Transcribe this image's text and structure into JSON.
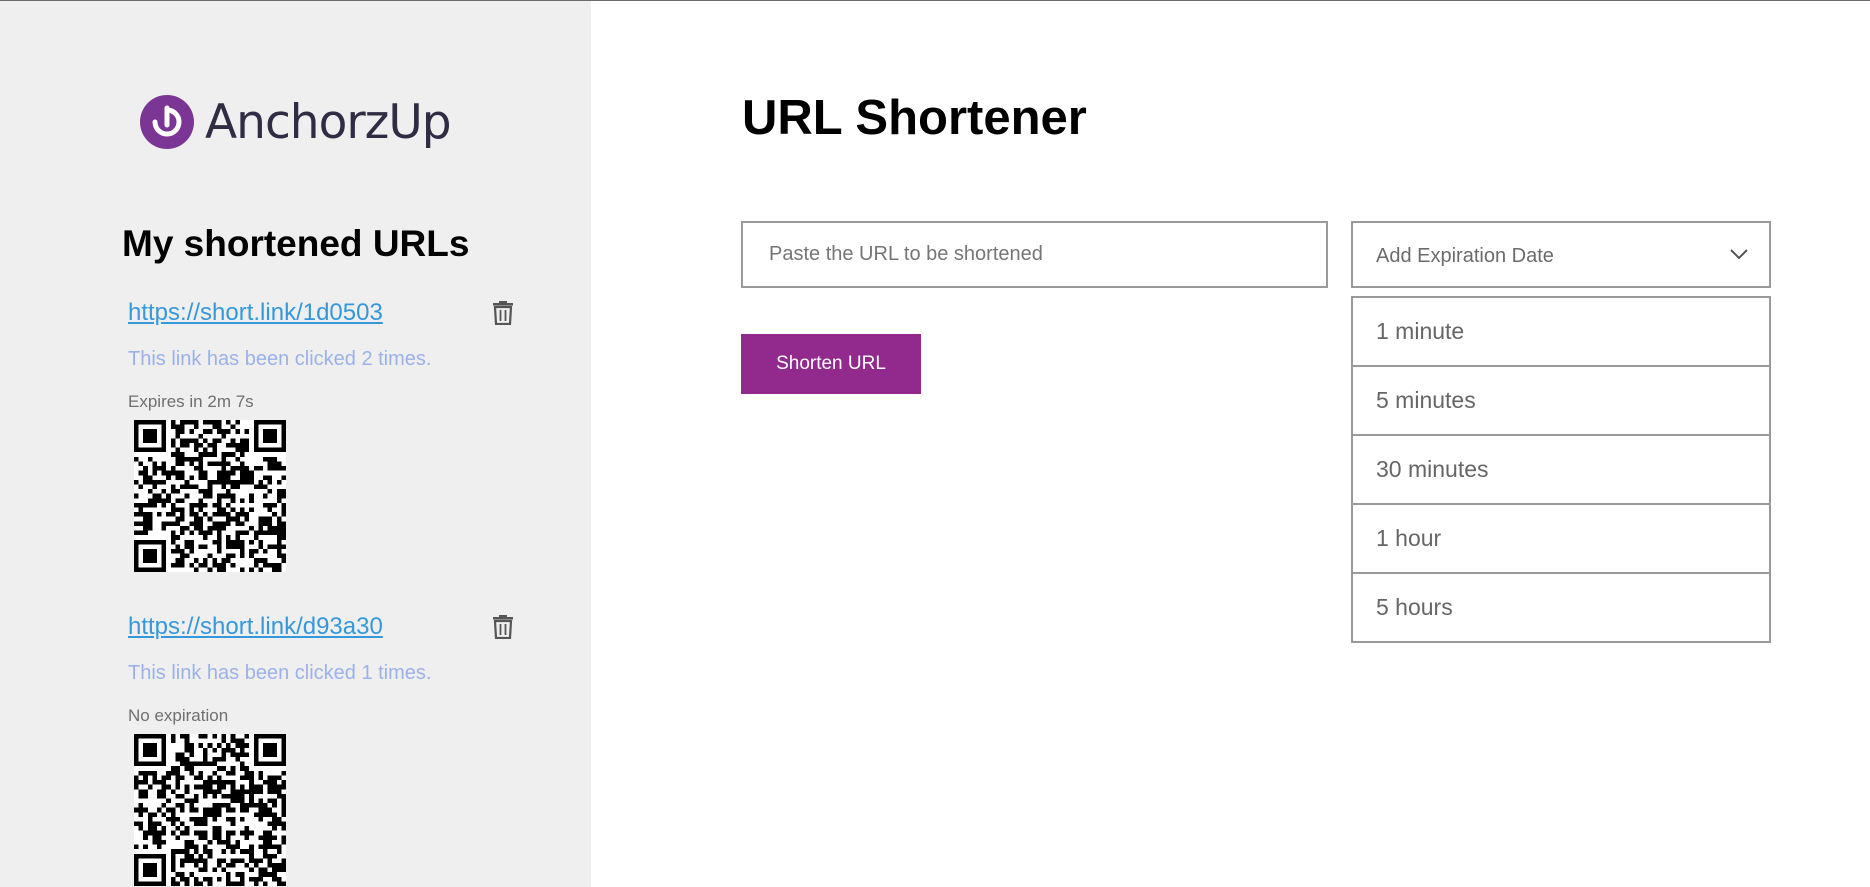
{
  "brand": {
    "name": "AnchorzUp",
    "color": "#7b3594",
    "logo_icon": "anchor-logo-icon"
  },
  "sidebar": {
    "title": "My shortened URLs",
    "links": [
      {
        "url": "https://short.link/1d0503",
        "clicks_text": "This link has been clicked 2 times.",
        "expiry_text": "Expires in 2m 7s",
        "delete_icon": "trash-icon"
      },
      {
        "url": "https://short.link/d93a30",
        "clicks_text": "This link has been clicked 1 times.",
        "expiry_text": "No expiration",
        "delete_icon": "trash-icon"
      }
    ]
  },
  "main": {
    "title": "URL Shortener",
    "url_input": {
      "value": "",
      "placeholder": "Paste the URL to be shortened"
    },
    "shorten_button": {
      "label": "Shorten URL",
      "color": "#922a8e"
    },
    "expiration": {
      "placeholder": "Add Expiration Date",
      "open": true,
      "options": [
        "1 minute",
        "5 minutes",
        "30 minutes",
        "1 hour",
        "5 hours"
      ]
    }
  },
  "colors": {
    "link": "#3498db",
    "clicks_text": "#9bb1ea",
    "sidebar_bg": "#efefef",
    "border": "#9a9a9a"
  }
}
